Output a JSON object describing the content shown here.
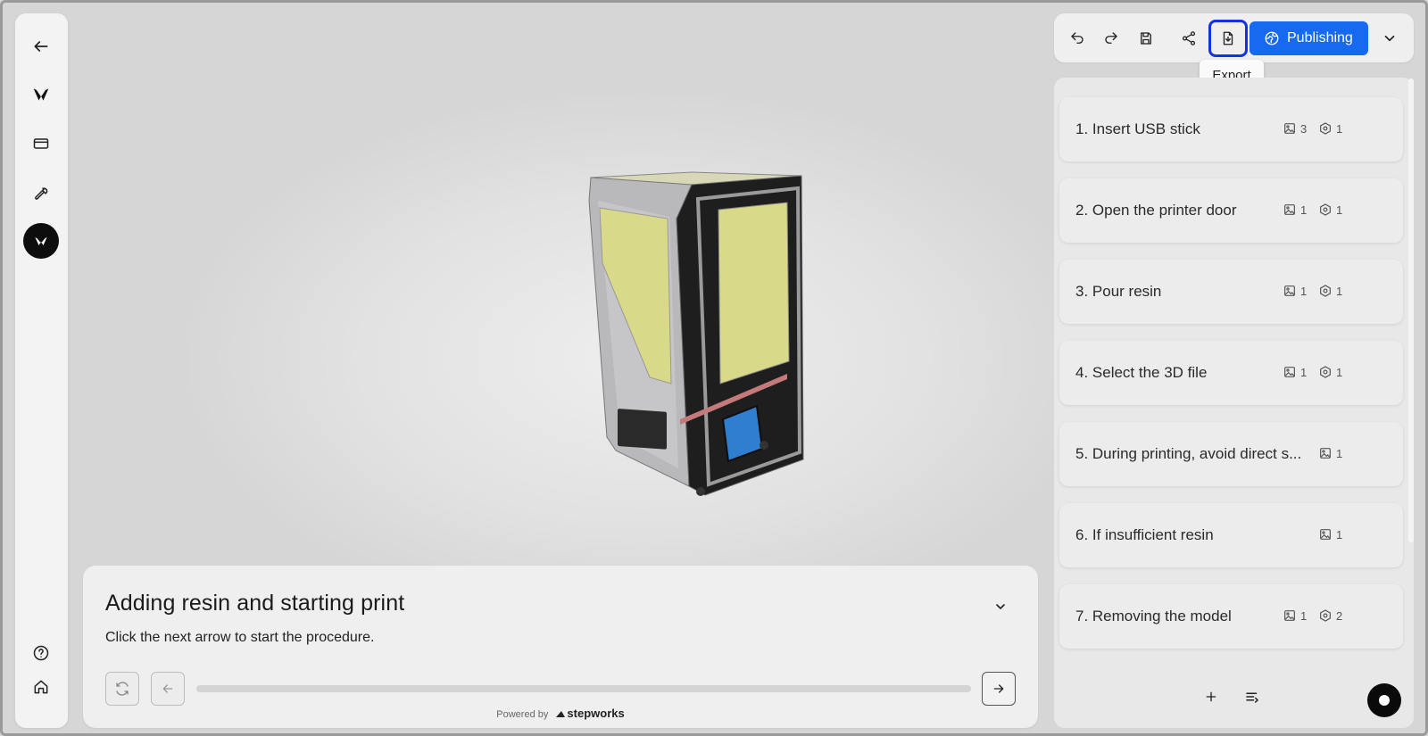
{
  "colors": {
    "accent": "#1769f0",
    "highlight_border": "#1433e0",
    "rail_active": "#0d0d0d",
    "screen_yellow": "#d9d98a",
    "screen_blue": "#2f7ed0"
  },
  "rail": {
    "icons": [
      "back-arrow-icon",
      "logo-icon",
      "card-icon",
      "wrench-icon",
      "workspace-icon",
      "help-icon",
      "home-icon"
    ]
  },
  "step_card": {
    "title": "Adding resin and starting print",
    "description": "Click the next arrow to start the procedure.",
    "progress_fraction": 0,
    "powered_by": "Powered by",
    "brand": "stepworks"
  },
  "toolbar": {
    "publish_label": "Publishing",
    "tooltip": "Export",
    "icons": [
      "undo-icon",
      "redo-icon",
      "save-icon",
      "share-icon",
      "export-icon",
      "globe-icon",
      "chevron-down-icon"
    ]
  },
  "steps": [
    {
      "label": "1. Insert USB stick",
      "images": "3",
      "hotspots": "1"
    },
    {
      "label": "2. Open the printer door",
      "images": "1",
      "hotspots": "1"
    },
    {
      "label": "3. Pour resin",
      "images": "1",
      "hotspots": "1"
    },
    {
      "label": "4. Select the 3D file",
      "images": "1",
      "hotspots": "1"
    },
    {
      "label": "5. During printing, avoid direct s...",
      "images": "1",
      "hotspots": null
    },
    {
      "label": "6. If insufficient resin",
      "images": "1",
      "hotspots": null
    },
    {
      "label": "7. Removing the model",
      "images": "1",
      "hotspots": "2"
    }
  ]
}
